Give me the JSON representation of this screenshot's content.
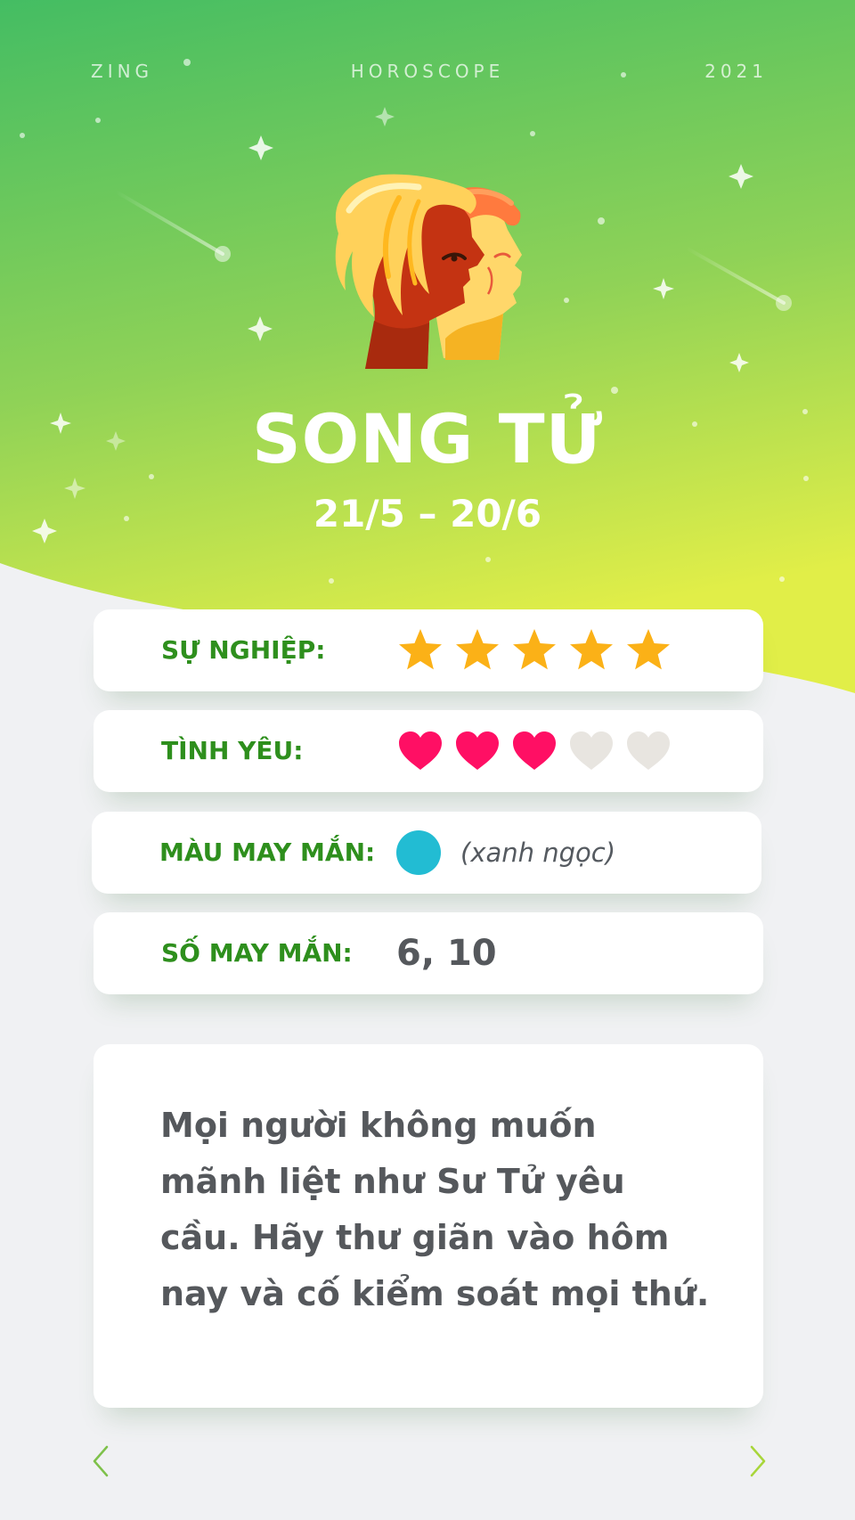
{
  "header": {
    "brand": "ZING",
    "section": "HOROSCOPE",
    "year": "2021"
  },
  "sign": {
    "name": "SONG TỬ",
    "dates": "21/5 – 20/6"
  },
  "ratings": {
    "career": {
      "label": "SỰ NGHIỆP:",
      "value": 5,
      "max": 5,
      "icon": "star-icon"
    },
    "love": {
      "label": "TÌNH YÊU:",
      "value": 3,
      "max": 5,
      "icon": "heart-icon"
    }
  },
  "lucky_color": {
    "label": "MÀU MAY MẮN:",
    "name": "(xanh ngọc)",
    "hex": "#22bcd3"
  },
  "lucky_number": {
    "label": "SỐ MAY MẮN:",
    "value": "6, 10"
  },
  "message": "Mọi người không muốn mãnh liệt như Sư Tử yêu cầu. Hãy thư giãn vào hôm nay và cố kiểm soát mọi thứ.",
  "colors": {
    "label_green": "#2e8f1d",
    "star": "#fbb117",
    "heart_on": "#ff0f64",
    "heart_off": "#e8e5e0",
    "hero_top": "#44bd63",
    "hero_bottom": "#d6ea47",
    "arrow_prev": "#7ec14a",
    "arrow_next": "#a8d63a"
  },
  "nav": {
    "prev_icon": "chevron-left-icon",
    "next_icon": "chevron-right-icon"
  }
}
